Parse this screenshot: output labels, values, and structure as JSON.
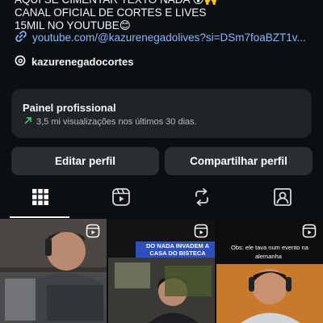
{
  "bio": {
    "line1": "AQUI SE CIMENTAR TEXTO NADA 😮🙌",
    "line2": "CANAL OFICIAL DE CORTES E LIVES",
    "line3": "15MIL NO YOUTUBE😊"
  },
  "link": {
    "icon": "link-icon",
    "text": "youtube.com/@kazurenegadolives?si=DSm7foaBZT1v..."
  },
  "threads": {
    "icon": "threads-icon",
    "handle": "kazurenegadocortes"
  },
  "professional_panel": {
    "title": "Painel profissional",
    "stats": "3,5 mi visualizações nos últimos 30 dias.",
    "trend_icon": "trend-up-arrow-icon",
    "accent": "#4ad66d"
  },
  "buttons": {
    "edit": "Editar perfil",
    "share": "Compartilhar perfil"
  },
  "tabs": [
    {
      "icon": "grid-icon",
      "active": true
    },
    {
      "icon": "reels-icon",
      "active": false
    },
    {
      "icon": "reposts-icon",
      "active": false
    },
    {
      "icon": "tagged-icon",
      "active": false
    }
  ],
  "posts": [
    {
      "type": "reel",
      "caption": ""
    },
    {
      "type": "reel",
      "caption": "DO NADA INVADEM A CASA DO BISTECA"
    },
    {
      "type": "reel",
      "caption_line1": "Obs: ele tava num evento na",
      "caption_line2": "alemanha"
    }
  ]
}
